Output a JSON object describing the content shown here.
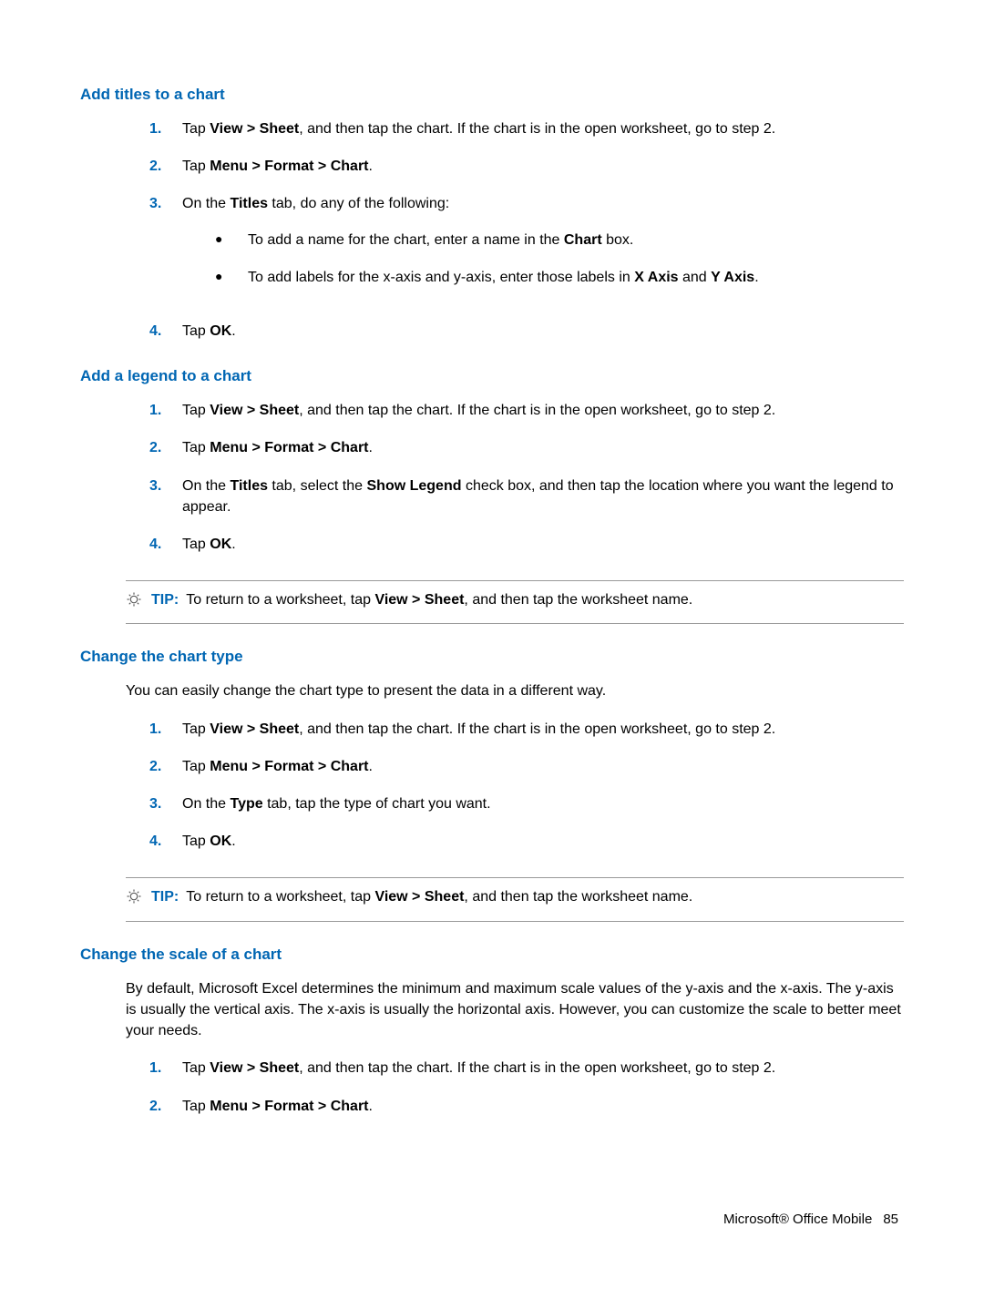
{
  "sections": {
    "add_titles": {
      "heading": "Add titles to a chart",
      "steps": {
        "s1": {
          "num": "1.",
          "pre": "Tap ",
          "bold": "View > Sheet",
          "post": ", and then tap the chart. If the chart is in the open worksheet, go to step 2."
        },
        "s2": {
          "num": "2.",
          "pre": "Tap ",
          "bold": "Menu > Format > Chart",
          "post": "."
        },
        "s3": {
          "num": "3.",
          "pre": "On the ",
          "bold": "Titles",
          "post": " tab, do any of the following:"
        },
        "s3a": {
          "pre": "To add a name for the chart, enter a name in the ",
          "bold": "Chart",
          "post": " box."
        },
        "s3b": {
          "pre": "To add labels for the x-axis and y-axis, enter those labels in ",
          "bold1": "X Axis",
          "mid": " and ",
          "bold2": "Y Axis",
          "post": "."
        },
        "s4": {
          "num": "4.",
          "pre": "Tap ",
          "bold": "OK",
          "post": "."
        }
      }
    },
    "add_legend": {
      "heading": "Add a legend to a chart",
      "steps": {
        "s1": {
          "num": "1.",
          "pre": "Tap ",
          "bold": "View > Sheet",
          "post": ", and then tap the chart. If the chart is in the open worksheet, go to step 2."
        },
        "s2": {
          "num": "2.",
          "pre": "Tap ",
          "bold": "Menu > Format > Chart",
          "post": "."
        },
        "s3": {
          "num": "3.",
          "pre": "On the ",
          "bold1": "Titles",
          "mid": " tab, select the ",
          "bold2": "Show Legend",
          "post": " check box, and then tap the location where you want the legend to appear."
        },
        "s4": {
          "num": "4.",
          "pre": "Tap ",
          "bold": "OK",
          "post": "."
        }
      },
      "tip": {
        "label": "TIP:",
        "pre": "To return to a worksheet, tap ",
        "bold": "View > Sheet",
        "post": ", and then tap the worksheet name."
      }
    },
    "change_type": {
      "heading": "Change the chart type",
      "intro": "You can easily change the chart type to present the data in a different way.",
      "steps": {
        "s1": {
          "num": "1.",
          "pre": "Tap ",
          "bold": "View > Sheet",
          "post": ", and then tap the chart. If the chart is in the open worksheet, go to step 2."
        },
        "s2": {
          "num": "2.",
          "pre": "Tap ",
          "bold": "Menu > Format > Chart",
          "post": "."
        },
        "s3": {
          "num": "3.",
          "pre": "On the ",
          "bold": "Type",
          "post": " tab, tap the type of chart you want."
        },
        "s4": {
          "num": "4.",
          "pre": "Tap ",
          "bold": "OK",
          "post": "."
        }
      },
      "tip": {
        "label": "TIP:",
        "pre": "To return to a worksheet, tap ",
        "bold": "View > Sheet",
        "post": ", and then tap the worksheet name."
      }
    },
    "change_scale": {
      "heading": "Change the scale of a chart",
      "intro": "By default, Microsoft Excel determines the minimum and maximum scale values of the y-axis and the x-axis. The y-axis is usually the vertical axis. The x-axis is usually the horizontal axis. However, you can customize the scale to better meet your needs.",
      "steps": {
        "s1": {
          "num": "1.",
          "pre": "Tap ",
          "bold": "View > Sheet",
          "post": ", and then tap the chart. If the chart is in the open worksheet, go to step 2."
        },
        "s2": {
          "num": "2.",
          "pre": "Tap ",
          "bold": "Menu > Format > Chart",
          "post": "."
        }
      }
    }
  },
  "footer": {
    "title": "Microsoft® Office Mobile",
    "page": "85"
  }
}
